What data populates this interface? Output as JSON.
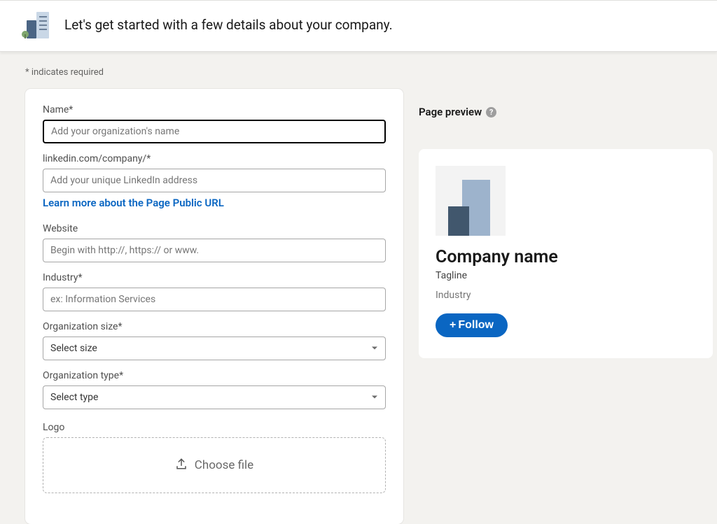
{
  "banner": {
    "headline": "Let's get started with a few details about your company."
  },
  "hints": {
    "required_note": "* indicates required"
  },
  "form": {
    "name": {
      "label": "Name*",
      "placeholder": "Add your organization's name"
    },
    "url": {
      "label": "linkedin.com/company/*",
      "placeholder": "Add your unique LinkedIn address",
      "help_link": "Learn more about the Page Public URL"
    },
    "website": {
      "label": "Website",
      "placeholder": "Begin with http://, https:// or www."
    },
    "industry": {
      "label": "Industry*",
      "placeholder": "ex: Information Services"
    },
    "size": {
      "label": "Organization size*",
      "selected": "Select size"
    },
    "type": {
      "label": "Organization type*",
      "selected": "Select type"
    },
    "logo": {
      "label": "Logo",
      "choose": "Choose file"
    }
  },
  "preview": {
    "header": "Page preview",
    "help_glyph": "?",
    "company_name": "Company name",
    "tagline": "Tagline",
    "industry": "Industry",
    "follow": "Follow"
  }
}
